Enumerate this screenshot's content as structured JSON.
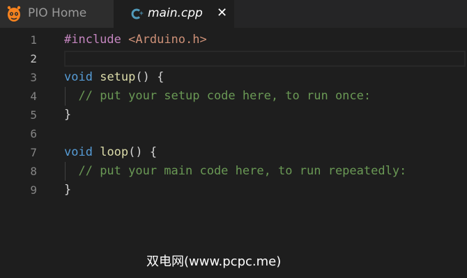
{
  "tabs": [
    {
      "label": "PIO Home",
      "icon": "platformio-alien-icon",
      "active": false
    },
    {
      "label": "main.cpp",
      "icon": "cpp-file-icon",
      "active": true,
      "close_glyph": "✕"
    }
  ],
  "colors": {
    "editor_bg": "#1e1e1e",
    "keyword": "#569cd6",
    "function": "#dcdcaa",
    "directive": "#c586c0",
    "string": "#ce9178",
    "comment": "#6a9955",
    "line_number": "#858585",
    "pio_orange": "#f5821f",
    "cpp_blue": "#519aba"
  },
  "editor": {
    "current_line": 2,
    "lines": [
      {
        "number": "1",
        "tokens": [
          {
            "t": "#include",
            "c": "directive"
          },
          {
            "t": " ",
            "c": "punct"
          },
          {
            "t": "<Arduino.h>",
            "c": "string"
          }
        ]
      },
      {
        "number": "2",
        "tokens": []
      },
      {
        "number": "3",
        "tokens": [
          {
            "t": "void",
            "c": "keyword"
          },
          {
            "t": " ",
            "c": "punct"
          },
          {
            "t": "setup",
            "c": "function"
          },
          {
            "t": "() {",
            "c": "punct"
          }
        ]
      },
      {
        "number": "4",
        "tokens": [
          {
            "t": "  ",
            "c": "punct"
          },
          {
            "t": "// put your setup code here, to run once:",
            "c": "comment"
          }
        ]
      },
      {
        "number": "5",
        "tokens": [
          {
            "t": "}",
            "c": "punct"
          }
        ]
      },
      {
        "number": "6",
        "tokens": []
      },
      {
        "number": "7",
        "tokens": [
          {
            "t": "void",
            "c": "keyword"
          },
          {
            "t": " ",
            "c": "punct"
          },
          {
            "t": "loop",
            "c": "function"
          },
          {
            "t": "() {",
            "c": "punct"
          }
        ]
      },
      {
        "number": "8",
        "tokens": [
          {
            "t": "  ",
            "c": "punct"
          },
          {
            "t": "// put your main code here, to run repeatedly:",
            "c": "comment"
          }
        ]
      },
      {
        "number": "9",
        "tokens": [
          {
            "t": "}",
            "c": "punct"
          }
        ]
      }
    ]
  },
  "watermark": "双电网(www.pcpc.me)"
}
